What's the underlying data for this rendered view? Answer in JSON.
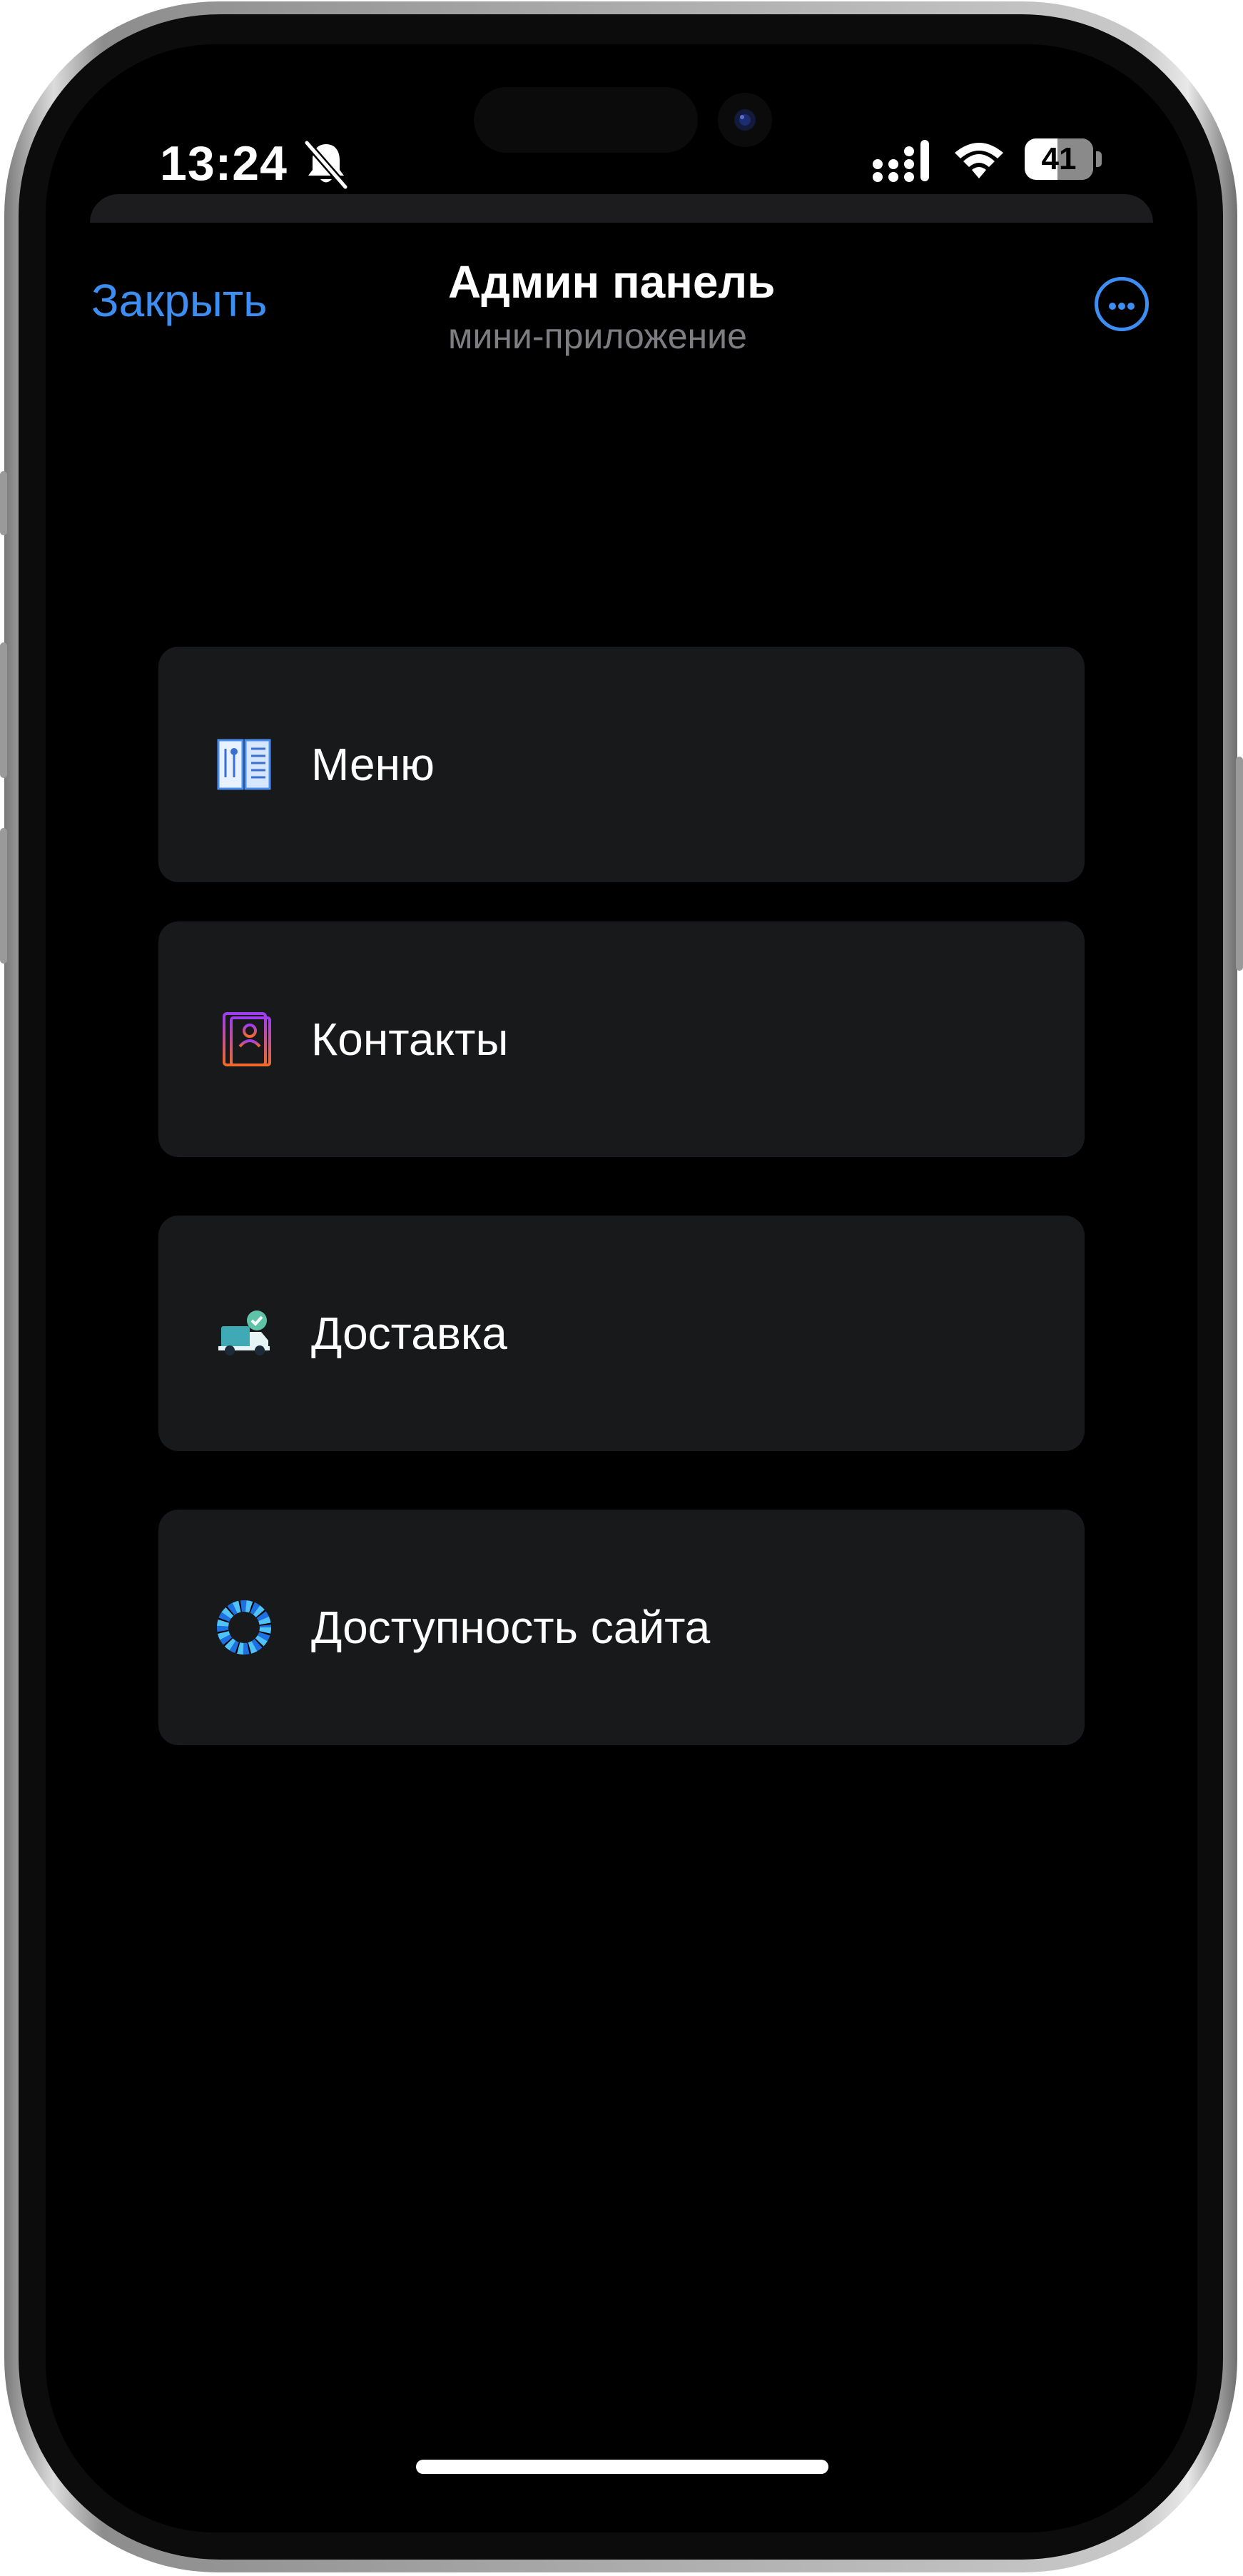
{
  "status_bar": {
    "time": "13:24",
    "battery_percent": "41"
  },
  "header": {
    "close_label": "Закрыть",
    "title": "Админ панель",
    "subtitle": "мини-приложение"
  },
  "menu_items": [
    {
      "label": "Меню",
      "icon": "menu-book-icon"
    },
    {
      "label": "Контакты",
      "icon": "contacts-book-icon"
    },
    {
      "label": "Доставка",
      "icon": "delivery-truck-icon"
    },
    {
      "label": "Доступность сайта",
      "icon": "site-availability-icon"
    }
  ],
  "colors": {
    "accent": "#3d8ef2",
    "card_background": "#18191a",
    "background": "#000000"
  }
}
